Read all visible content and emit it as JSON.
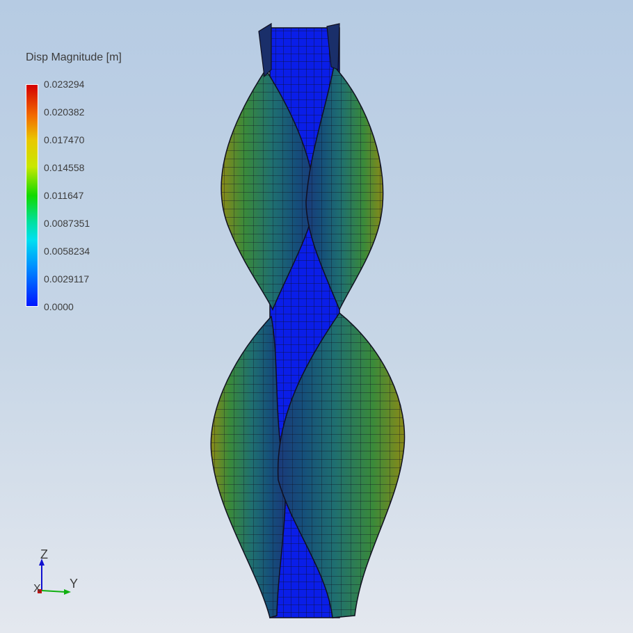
{
  "legend": {
    "title": "Disp Magnitude [m]",
    "ticks": [
      "0.023294",
      "0.020382",
      "0.017470",
      "0.014558",
      "0.011647",
      "0.0087351",
      "0.0058234",
      "0.0029117",
      "0.0000"
    ]
  },
  "triad": {
    "z": "Z",
    "y": "Y",
    "x": "X"
  },
  "colors": {
    "max": "#d40000",
    "min": "#0016ff",
    "mesh": "#101020"
  }
}
